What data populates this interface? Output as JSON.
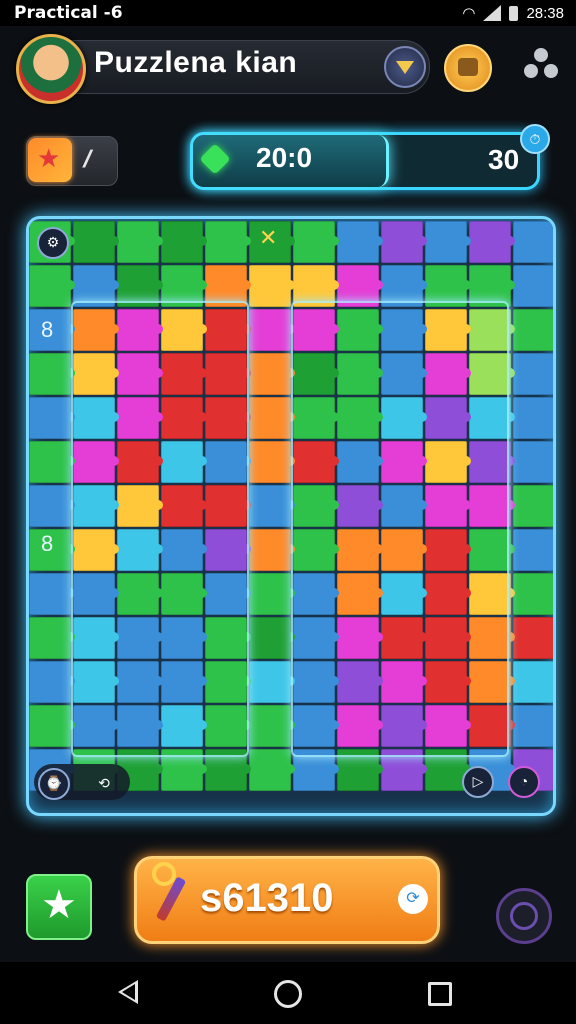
{
  "status_bar": {
    "left_text": "Practical  -6",
    "time": "28:38"
  },
  "header": {
    "title": "Puzzlena kian",
    "icons": [
      "avatar",
      "dropdown-icon",
      "bag-icon",
      "profile-icon"
    ]
  },
  "booster": {
    "icon": "booster-icon",
    "edit_label": "/"
  },
  "progress": {
    "current": "20:0",
    "max": "30",
    "fraction": 0.56,
    "gem_icon": "gem-icon",
    "badge": "⏱"
  },
  "board": {
    "left_icons": [
      "8",
      "8"
    ],
    "close_icon": "✕",
    "rows": 13,
    "cols": 12,
    "palette": {
      "g": "#2fc24a",
      "G": "#1fa034",
      "o": "#ff8a2a",
      "y": "#ffc83a",
      "m": "#e43ed6",
      "r": "#e0302f",
      "c": "#3dc6e8",
      "b": "#3a8fd8",
      "p": "#8f4ed8",
      "l": "#9be05a",
      "t": "#2fb8b0"
    },
    "tiles": [
      "gGgGgGgbpbpb",
      "gbGgoyymbggb",
      "bomyrmmgbylg",
      "gymrroGgbmlb",
      "bcmrroggcpcb",
      "gmrcborbmypb",
      "bcyrrbgpbmmg",
      "gycbpogoorgb",
      "bbggbgbocryg",
      "gcbbgGbmrror",
      "bcbbgcbpmroc",
      "gbbcggbmpmrb",
      "bgGgGgbGpGbp"
    ]
  },
  "bottom_controls": {
    "left_a": "⌚",
    "left_b": "⟲",
    "right_a": "▷",
    "right_b": "◔"
  },
  "actions": {
    "buy_value": "s61310",
    "chat_icon": "⟳"
  },
  "nav_bar": {
    "buttons": [
      "back",
      "home",
      "recents"
    ]
  }
}
